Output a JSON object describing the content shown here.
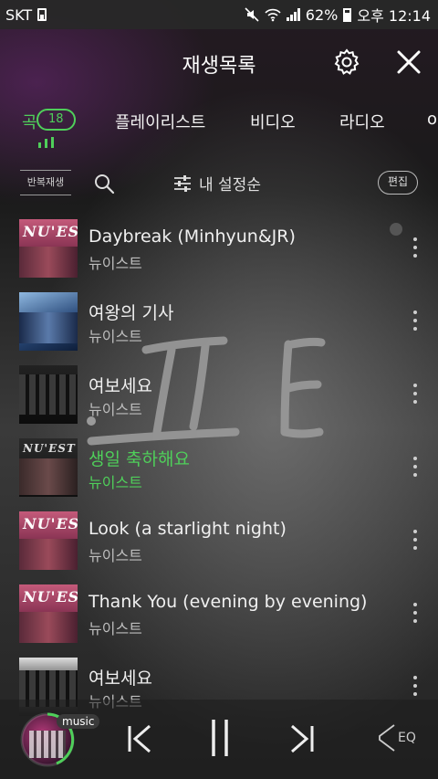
{
  "status_bar": {
    "carrier": "SKT",
    "battery": "62%",
    "time": "오후 12:14",
    "icons": [
      "sim-icon",
      "mute-icon",
      "wifi-icon",
      "signal-icon",
      "battery-icon"
    ]
  },
  "header": {
    "title": "재생목록",
    "settings_icon": "gear-icon",
    "close_icon": "close-icon"
  },
  "tabs": [
    {
      "label": "곡",
      "count": "18",
      "active": true
    },
    {
      "label": "플레이리스트",
      "active": false
    },
    {
      "label": "비디오",
      "active": false
    },
    {
      "label": "라디오",
      "active": false
    },
    {
      "label": "o",
      "active": false
    }
  ],
  "toolbar": {
    "repeat_label": "반복재생",
    "sort_label": "내 설정순",
    "edit_label": "편집"
  },
  "songs": [
    {
      "title": "Daybreak (Minhyun&JR)",
      "artist": "뉴이스트",
      "cover": "nuest-pink",
      "playing": false
    },
    {
      "title": "여왕의 기사",
      "artist": "뉴이스트",
      "cover": "blue",
      "playing": false
    },
    {
      "title": "여보세요",
      "artist": "뉴이스트",
      "cover": "dark",
      "playing": false
    },
    {
      "title": "생일 축하해요",
      "artist": "뉴이스트",
      "cover": "nuest-dark",
      "playing": true
    },
    {
      "title": "Look (a starlight night)",
      "artist": "뉴이스트",
      "cover": "nuest-pink",
      "playing": false
    },
    {
      "title": "Thank You (evening by evening)",
      "artist": "뉴이스트",
      "cover": "nuest-pink",
      "playing": false
    },
    {
      "title": "여보세요",
      "artist": "뉴이스트",
      "cover": "dark",
      "playing": false
    }
  ],
  "player": {
    "badge": "music",
    "eq_label": "EQ",
    "accent": "#4fcf5a"
  },
  "colors": {
    "accent": "#4fcf5a",
    "text": "#f0f0f0",
    "subtext": "#bdbdbd"
  }
}
